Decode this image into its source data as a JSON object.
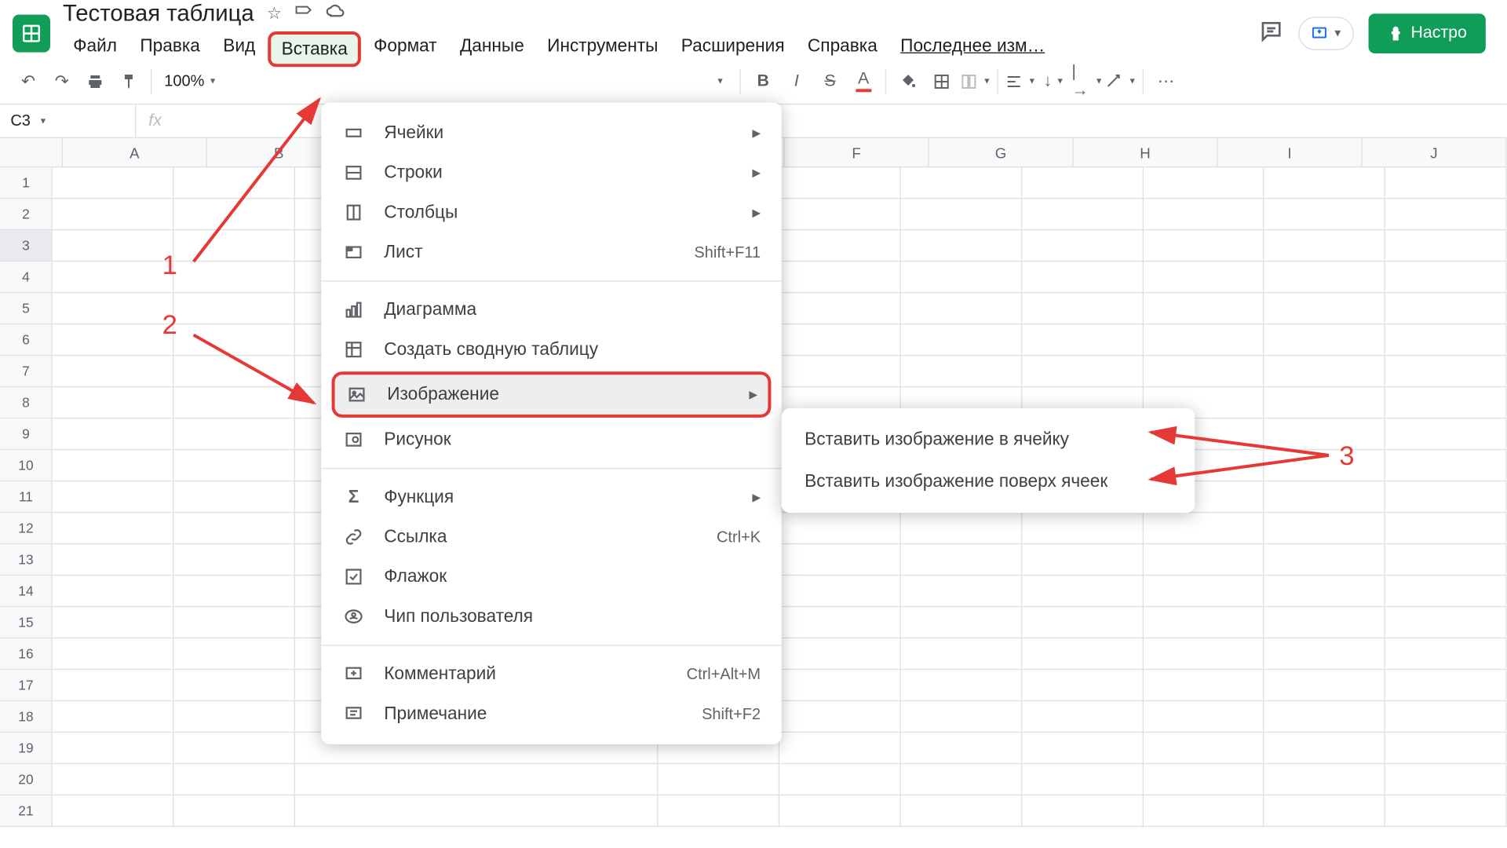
{
  "doc": {
    "title": "Тестовая таблица"
  },
  "menu": {
    "file": "Файл",
    "edit": "Правка",
    "view": "Вид",
    "insert": "Вставка",
    "format": "Формат",
    "data": "Данные",
    "tools": "Инструменты",
    "extensions": "Расширения",
    "help": "Справка",
    "lastedit": "Последнее изм…"
  },
  "share": "Настро",
  "zoom": "100%",
  "namebox": "C3",
  "cols": [
    "A",
    "B",
    "F",
    "G",
    "H",
    "I",
    "J"
  ],
  "rows": [
    1,
    2,
    3,
    4,
    5,
    6,
    7,
    8,
    9,
    10,
    11,
    12,
    13,
    14,
    15,
    16,
    17,
    18,
    19,
    20,
    21
  ],
  "dropdown": {
    "cells": "Ячейки",
    "rows": "Строки",
    "columns": "Столбцы",
    "sheet": "Лист",
    "sheet_sc": "Shift+F11",
    "chart": "Диаграмма",
    "pivot": "Создать сводную таблицу",
    "image": "Изображение",
    "drawing": "Рисунок",
    "function": "Функция",
    "link": "Ссылка",
    "link_sc": "Ctrl+K",
    "checkbox": "Флажок",
    "peoplechip": "Чип пользователя",
    "comment": "Комментарий",
    "comment_sc": "Ctrl+Alt+M",
    "note": "Примечание",
    "note_sc": "Shift+F2"
  },
  "submenu": {
    "in_cell": "Вставить изображение в ячейку",
    "over_cells": "Вставить изображение поверх ячеек"
  },
  "annot": {
    "n1": "1",
    "n2": "2",
    "n3": "3"
  }
}
